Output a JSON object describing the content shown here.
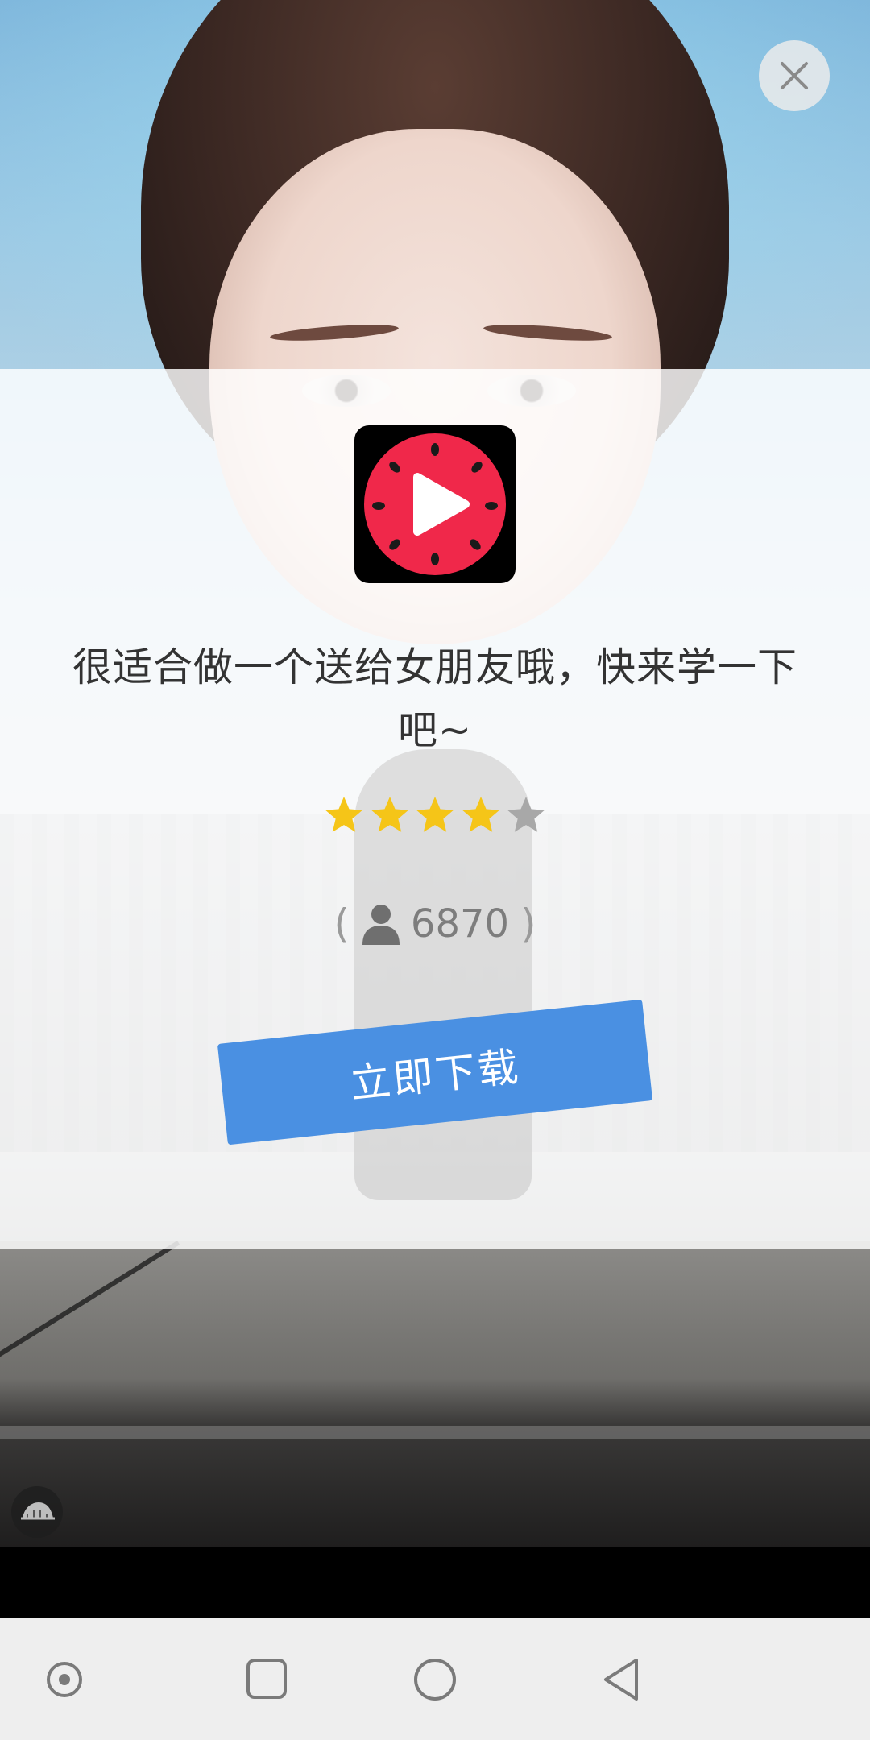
{
  "ad": {
    "description": "很适合做一个送给女朋友哦，快来学一下吧~",
    "rating": 4,
    "rating_max": 5,
    "user_count": "6870",
    "paren_open": "(",
    "paren_close": ")",
    "download_label": "立即下载"
  },
  "app_icon": {
    "icon": "watermelon-play-icon",
    "background": "#000000",
    "accent": "#f0284a"
  },
  "colors": {
    "star_filled": "#f5c518",
    "star_empty": "#a8a8a8",
    "button": "#4a90e2",
    "text": "#333333"
  },
  "overlay": {
    "close_icon": "close-icon",
    "badge_icon": "turtle-icon"
  },
  "navbar": {
    "buttons": [
      "circle-dot-icon",
      "square-icon",
      "circle-icon",
      "triangle-back-icon"
    ]
  }
}
